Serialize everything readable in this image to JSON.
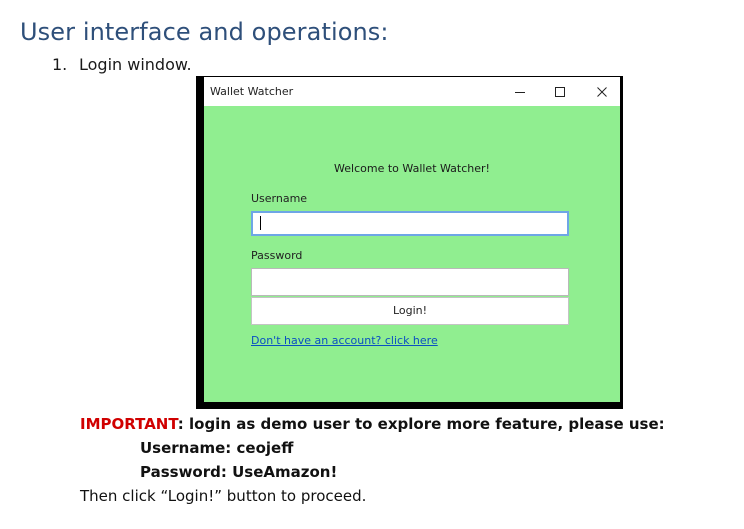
{
  "document": {
    "heading": "User interface and operations:",
    "list_number": "1.",
    "list_item": "Login window."
  },
  "window": {
    "title": "Wallet Watcher",
    "minimize_icon": "minimize-icon",
    "maximize_icon": "maximize-icon",
    "close_icon": "close-icon",
    "welcome": "Welcome to Wallet Watcher!",
    "username_label": "Username",
    "username_value": "",
    "password_label": "Password",
    "password_value": "",
    "login_button": "Login!",
    "signup_link": "Don't have an account? click here",
    "background_color": "#90ee90"
  },
  "notes": {
    "important_label": "IMPORTANT",
    "important_text": ": login as demo user to explore more feature, please use:",
    "username_line": "Username: ceojeff",
    "password_line": "Password: UseAmazon!",
    "proceed_line": "Then click “Login!” button to proceed.",
    "important_color": "#d00000"
  }
}
